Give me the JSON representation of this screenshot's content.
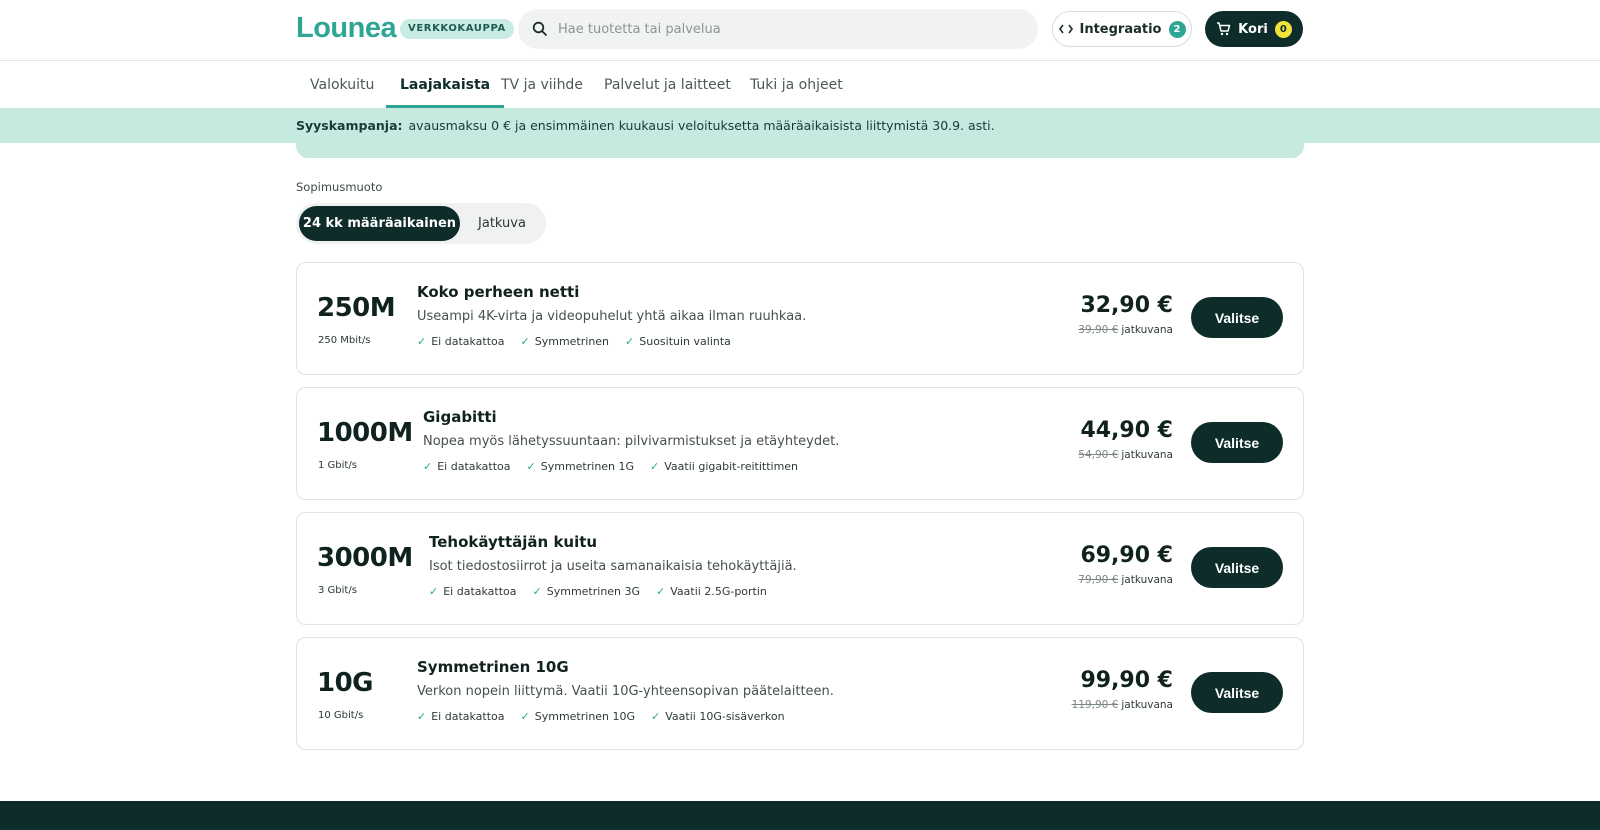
{
  "header": {
    "logo": "Lounea",
    "shop_badge": "VERKKOKAUPPA",
    "search_placeholder": "Hae tuotetta tai palvelua",
    "integration_label": "Integraatio",
    "integration_count": "2",
    "cart_label": "Kori",
    "cart_count": "0"
  },
  "nav": {
    "tabs": [
      {
        "label": "Valokuitu"
      },
      {
        "label": "Laajakaista",
        "active": true
      },
      {
        "label": "TV ja viihde"
      },
      {
        "label": "Palvelut ja laitteet"
      },
      {
        "label": "Tuki ja ohjeet"
      }
    ]
  },
  "promo": {
    "title": "Syyskampanja:",
    "text": "avausmaksu 0 € ja ensimmäinen kuukausi veloituksetta määräaikaisista liittymistä 30.9. asti."
  },
  "contract": {
    "label": "Sopimusmuoto",
    "options": [
      "24 kk määräaikainen",
      "Jatkuva"
    ],
    "selected": "24 kk määräaikainen"
  },
  "plans": [
    {
      "speed": "250M",
      "mbit": "250 Mbit/s",
      "name": "Koko perheen netti",
      "desc": "Useampi 4K-virta ja videopuhelut yhtä aikaa ilman ruuhkaa.",
      "features": [
        "Ei datakattoa",
        "Symmetrinen",
        "Suosituin valinta"
      ],
      "price": "32,90 €",
      "old_price": "39,90 €",
      "old_suffix": "jatkuvana",
      "button": "Valitse"
    },
    {
      "speed": "1000M",
      "mbit": "1 Gbit/s",
      "name": "Gigabitti",
      "desc": "Nopea myös lähetyssuuntaan: pilvivarmistukset ja etäyhteydet.",
      "features": [
        "Ei datakattoa",
        "Symmetrinen 1G",
        "Vaatii gigabit-reitittimen"
      ],
      "price": "44,90 €",
      "old_price": "54,90 €",
      "old_suffix": "jatkuvana",
      "button": "Valitse"
    },
    {
      "speed": "3000M",
      "mbit": "3 Gbit/s",
      "name": "Tehokäyttäjän kuitu",
      "desc": "Isot tiedostosiirrot ja useita samanaikaisia tehokäyttäjiä.",
      "features": [
        "Ei datakattoa",
        "Symmetrinen 3G",
        "Vaatii 2.5G-portin"
      ],
      "price": "69,90 €",
      "old_price": "79,90 €",
      "old_suffix": "jatkuvana",
      "button": "Valitse"
    },
    {
      "speed": "10G",
      "mbit": "10 Gbit/s",
      "name": "Symmetrinen 10G",
      "desc": "Verkon nopein liittymä. Vaatii 10G-yhteensopivan päätelaitteen.",
      "features": [
        "Ei datakattoa",
        "Symmetrinen 10G",
        "Vaatii 10G-sisäverkon"
      ],
      "price": "99,90 €",
      "old_price": "119,90 €",
      "old_suffix": "jatkuvana",
      "button": "Valitse"
    }
  ],
  "colors": {
    "accent": "#2fa596",
    "dark": "#0e2d2a",
    "banner": "#c6e9e0"
  }
}
